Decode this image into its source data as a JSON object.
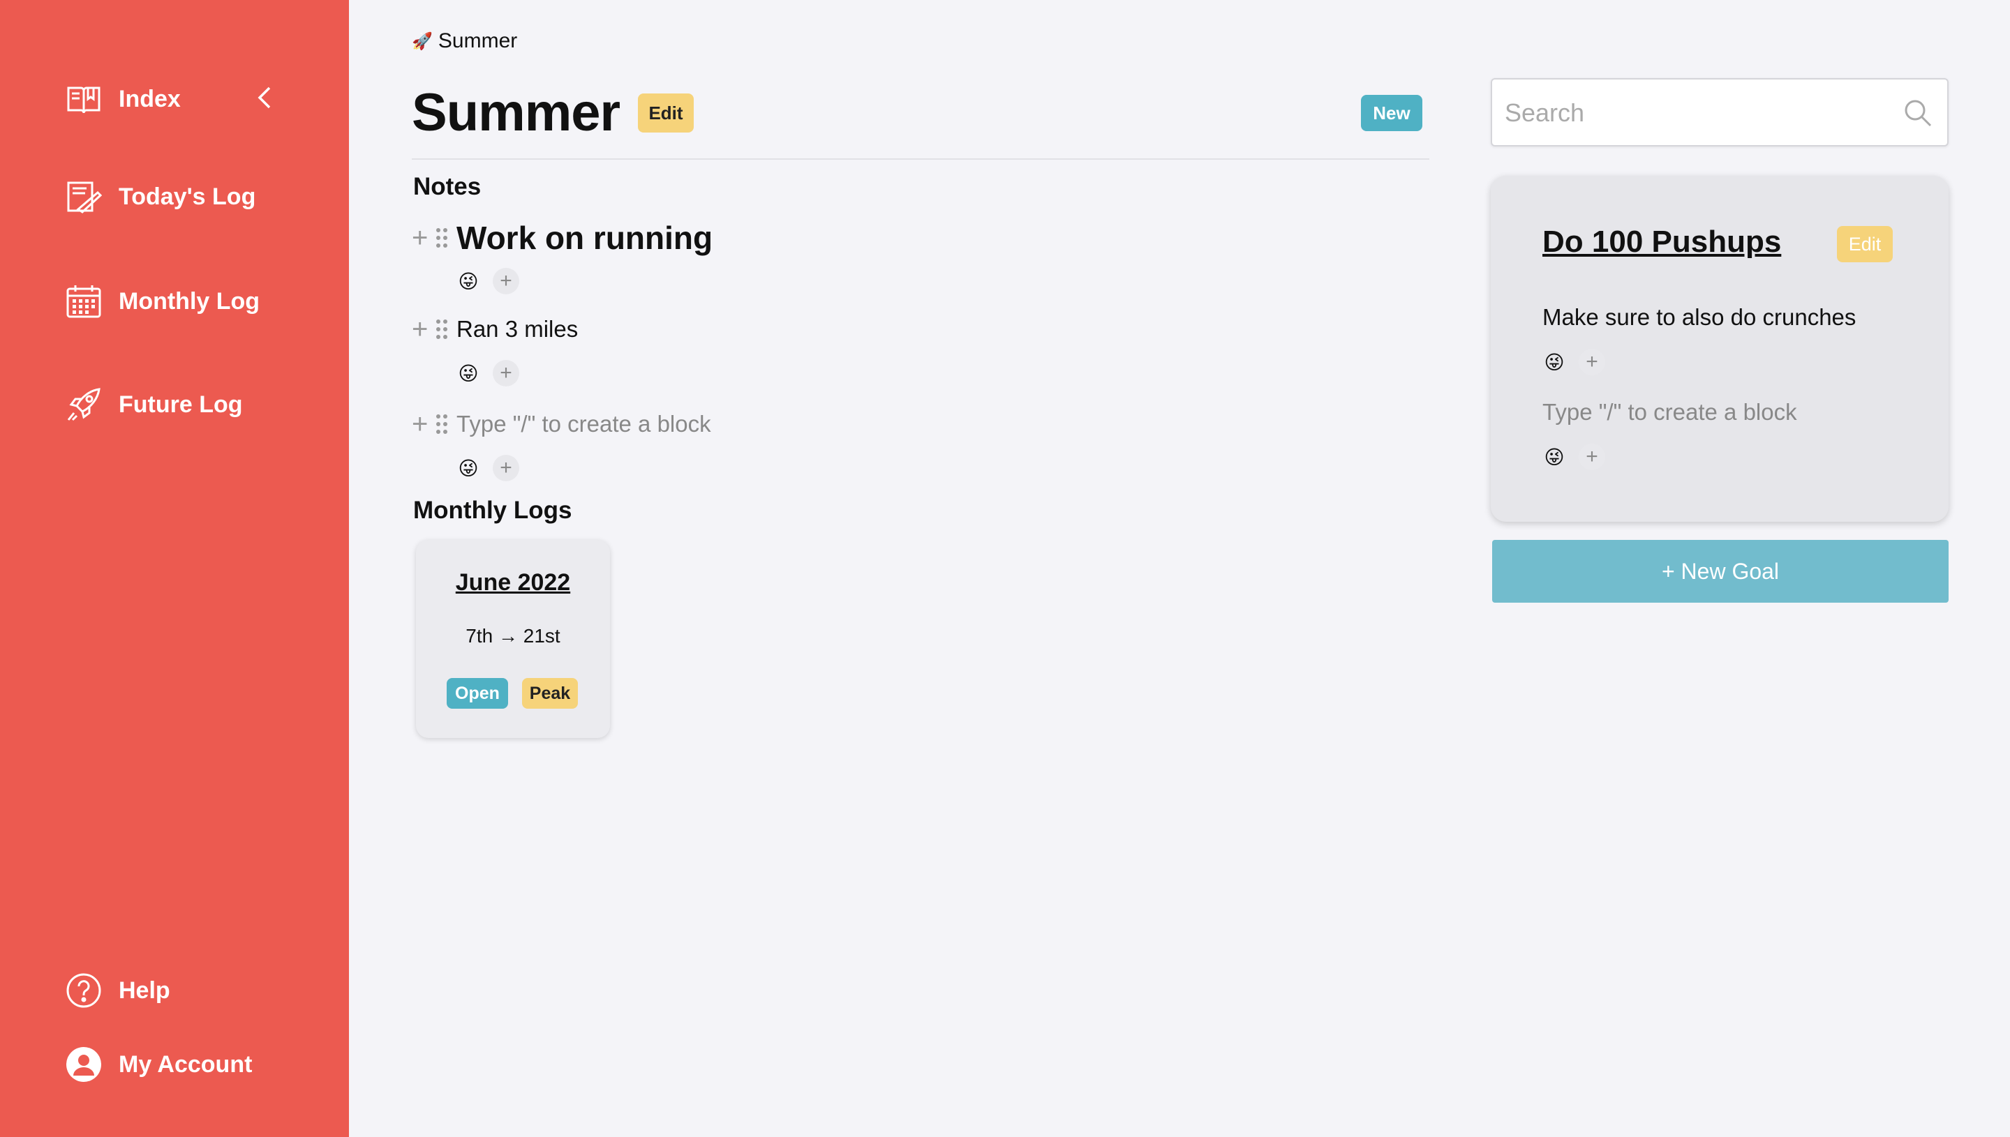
{
  "sidebar": {
    "items": [
      {
        "label": "Index",
        "icon": "book-icon"
      },
      {
        "label": "Today's Log",
        "icon": "writing-icon"
      },
      {
        "label": "Monthly Log",
        "icon": "calendar-icon"
      },
      {
        "label": "Future Log",
        "icon": "rocket-icon"
      }
    ],
    "bottom": [
      {
        "label": "Help",
        "icon": "help-icon"
      },
      {
        "label": "My Account",
        "icon": "account-icon"
      }
    ],
    "color": "#ec5a50"
  },
  "breadcrumb": {
    "icon": "🚀",
    "label": "Summer"
  },
  "page": {
    "title": "Summer",
    "edit_label": "Edit",
    "new_label": "New"
  },
  "notes": {
    "heading": "Notes",
    "blocks": [
      {
        "text": "Work on running",
        "emoji": "😜",
        "add": "+"
      },
      {
        "text": "Ran 3 miles",
        "emoji": "😜",
        "add": "+"
      },
      {
        "text": "Type \"/\" to create a block",
        "emoji": "😜",
        "add": "+"
      }
    ],
    "plus": "+"
  },
  "monthly_logs": {
    "heading": "Monthly Logs",
    "cards": [
      {
        "title": "June 2022",
        "range": "7th → 21st",
        "badge_open": "Open",
        "badge_peak": "Peak"
      }
    ]
  },
  "search": {
    "placeholder": "Search"
  },
  "goal": {
    "title": "Do 100 Pushups",
    "edit_label": "Edit",
    "blocks": [
      {
        "text": "Make sure to also do crunches",
        "emoji": "😜",
        "add": "+"
      },
      {
        "text": "Type \"/\" to create a block",
        "emoji": "😜",
        "add": "+"
      }
    ]
  },
  "new_goal_label": "+ New Goal",
  "colors": {
    "accent_blue": "#4fb1c4",
    "accent_yellow": "#f6d37a",
    "new_goal": "#72bccd"
  }
}
